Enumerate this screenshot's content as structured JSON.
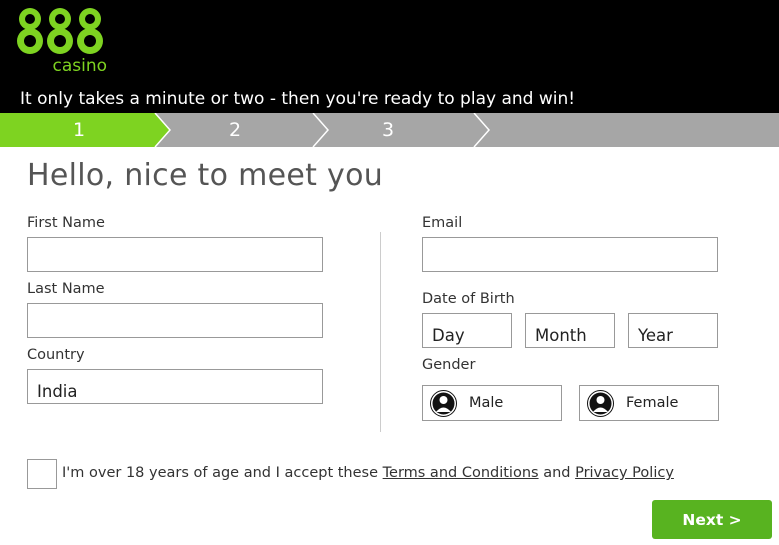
{
  "header": {
    "logo_number": "888",
    "logo_word": "casino",
    "tagline": "It only takes a minute or two - then you're ready to play and win!"
  },
  "steps": {
    "items": [
      "1",
      "2",
      "3"
    ],
    "active": 1
  },
  "form": {
    "title": "Hello, nice to meet you",
    "first_name": {
      "label": "First Name",
      "value": ""
    },
    "last_name": {
      "label": "Last Name",
      "value": ""
    },
    "country": {
      "label": "Country",
      "value": "India"
    },
    "email": {
      "label": "Email",
      "value": ""
    },
    "dob": {
      "label": "Date of Birth",
      "day": "Day",
      "month": "Month",
      "year": "Year"
    },
    "gender": {
      "label": "Gender",
      "male": "Male",
      "female": "Female"
    },
    "consent": {
      "prefix": "I'm over 18 years of age and I accept these",
      "terms": "Terms and Conditions",
      "and": "and",
      "privacy": "Privacy Policy"
    },
    "next_label": "Next >"
  },
  "colors": {
    "header_bg": "#000000",
    "brand_green": "#7ed321",
    "button_green": "#58b320",
    "step_grey": "#a6a6a6"
  }
}
